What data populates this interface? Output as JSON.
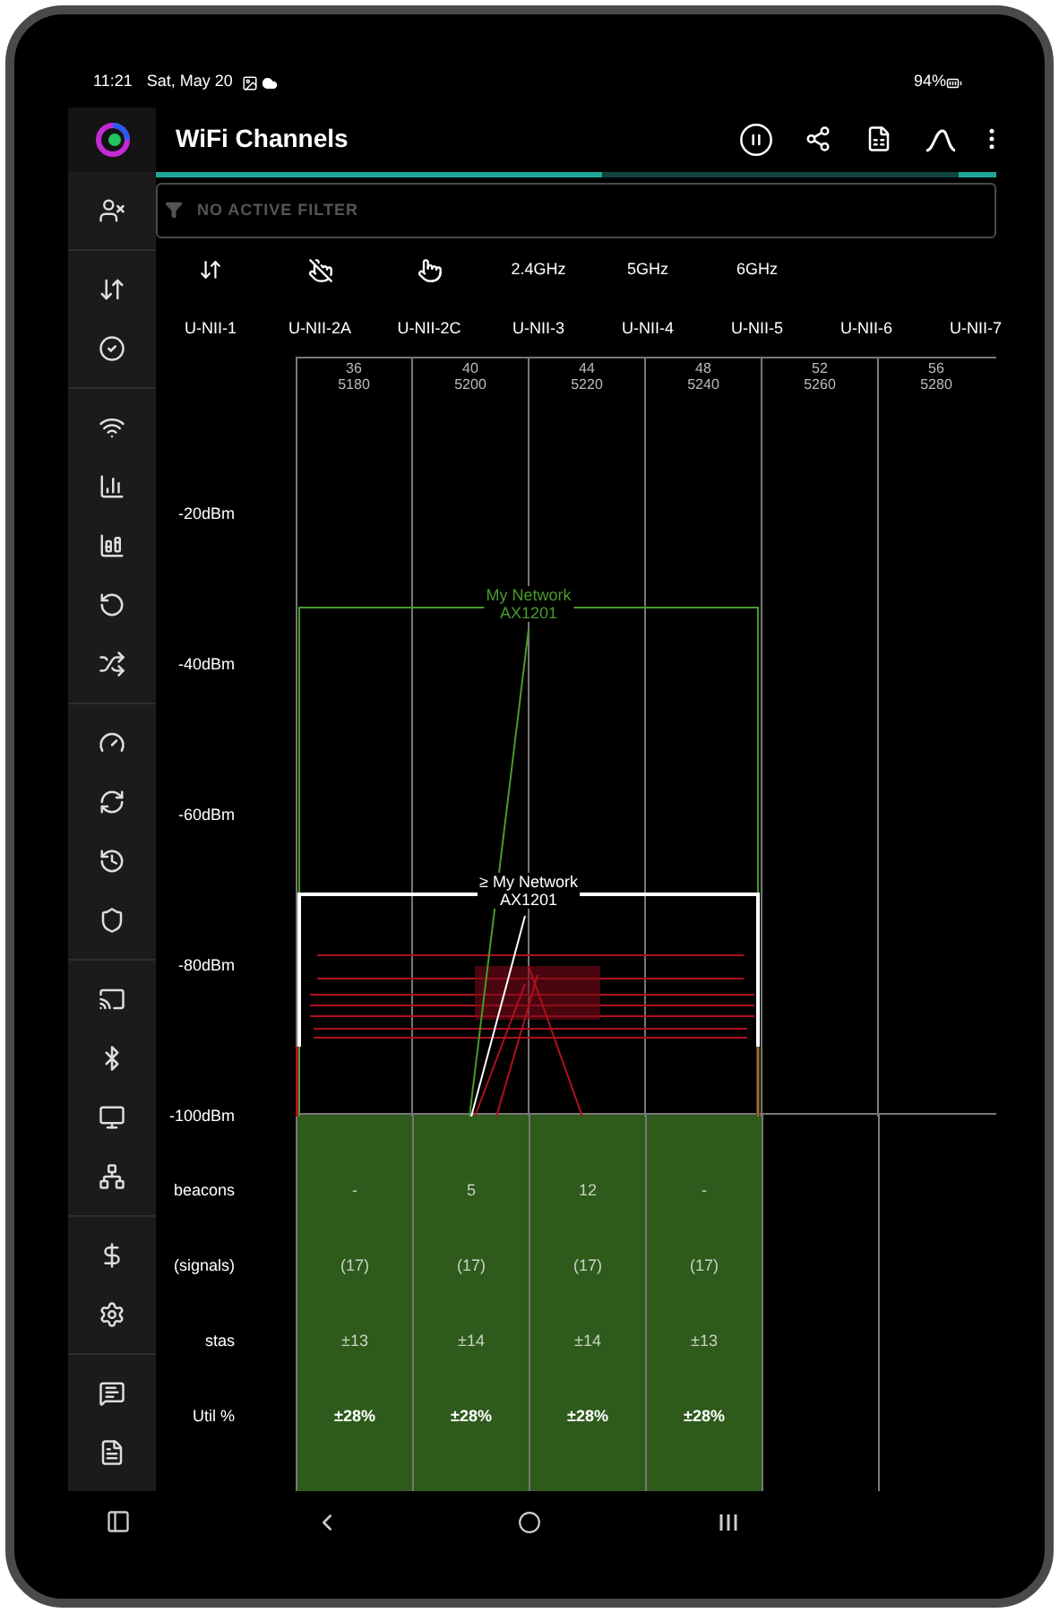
{
  "status_bar": {
    "time": "11:21",
    "date": "Sat, May 20",
    "battery": "94%"
  },
  "header": {
    "title": "WiFi Channels"
  },
  "progress": {
    "level": 0.53
  },
  "filter": {
    "placeholder": "NO ACTIVE FILTER"
  },
  "bands": [
    "2.4GHz",
    "5GHz",
    "6GHz"
  ],
  "sub_bands": [
    "U-NII-1",
    "U-NII-2A",
    "U-NII-2C",
    "U-NII-3",
    "U-NII-4",
    "U-NII-5",
    "U-NII-6",
    "U-NII-7"
  ],
  "channels": [
    {
      "number": "36",
      "frequency": "5180"
    },
    {
      "number": "40",
      "frequency": "5200"
    },
    {
      "number": "44",
      "frequency": "5220"
    },
    {
      "number": "48",
      "frequency": "5240"
    },
    {
      "number": "52",
      "frequency": "5260"
    },
    {
      "number": "56",
      "frequency": "5280"
    }
  ],
  "y_axis": [
    "-20dBm",
    "-40dBm",
    "-60dBm",
    "-80dBm",
    "-100dBm"
  ],
  "networks": [
    {
      "name": "My Network",
      "model": "AX1201",
      "color": "#4a9a2c"
    },
    {
      "name": "≥ My Network",
      "model": "AX1201",
      "color": "#ffffff"
    }
  ],
  "table": {
    "rows": [
      {
        "label": "beacons",
        "cells": [
          "-",
          "5",
          "12",
          "-"
        ]
      },
      {
        "label": "(signals)",
        "cells": [
          "(17)",
          "(17)",
          "(17)",
          "(17)"
        ]
      },
      {
        "label": "stas",
        "cells": [
          "±13",
          "±14",
          "±14",
          "±13"
        ]
      },
      {
        "label": "Util %",
        "cells": [
          "±28%",
          "±28%",
          "±28%",
          "±28%"
        ]
      }
    ]
  }
}
